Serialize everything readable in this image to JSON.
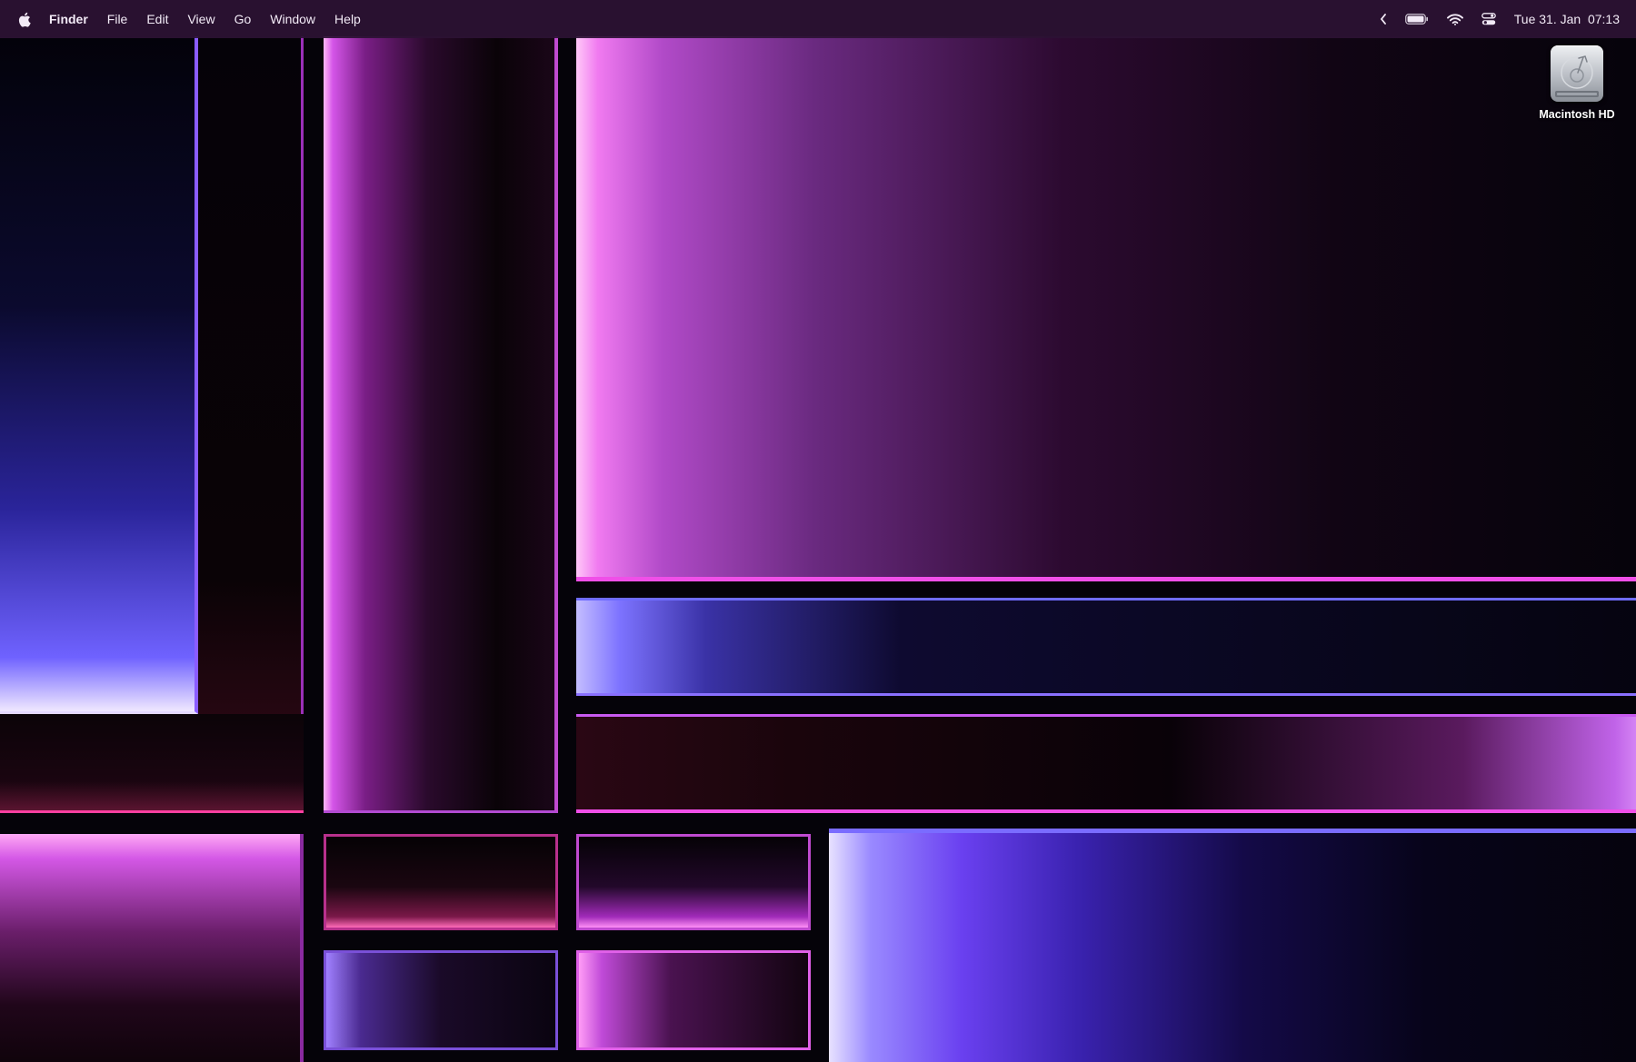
{
  "menubar": {
    "app_name": "Finder",
    "items": [
      {
        "label": "File"
      },
      {
        "label": "Edit"
      },
      {
        "label": "View"
      },
      {
        "label": "Go"
      },
      {
        "label": "Window"
      },
      {
        "label": "Help"
      }
    ],
    "status": {
      "icons": [
        "chevron-left-icon",
        "battery-icon",
        "wifi-icon",
        "control-center-icon"
      ],
      "date": "Tue 31. Jan",
      "time": "07:13"
    }
  },
  "desktop": {
    "icons": [
      {
        "label": "Macintosh HD",
        "icon": "hard-disk-icon"
      }
    ]
  },
  "colors": {
    "menubar_bg": "#2c1234",
    "magenta": "#e040e8",
    "violet": "#6a55ff",
    "pink_glow": "#ff9cf6",
    "background": "#050309"
  }
}
